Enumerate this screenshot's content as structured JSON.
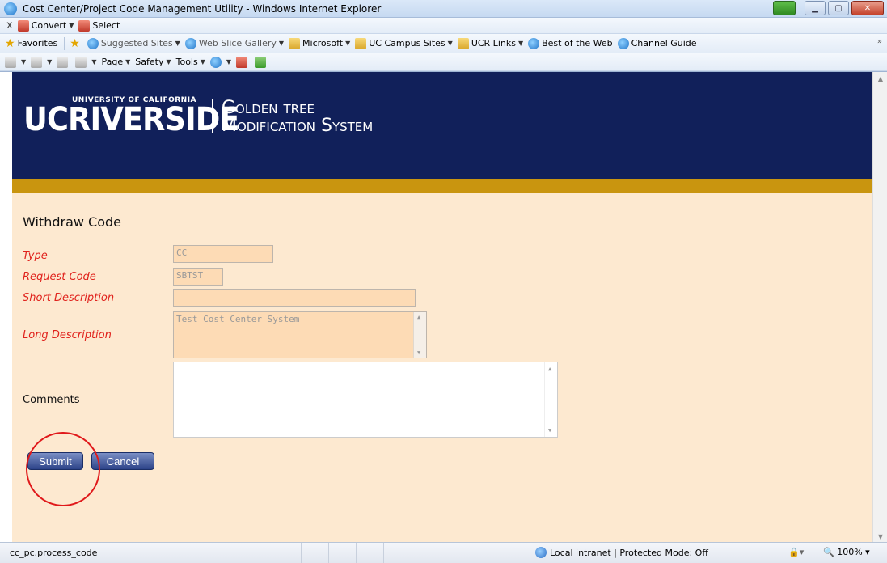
{
  "window": {
    "title": "Cost Center/Project Code Management Utility - Windows Internet Explorer"
  },
  "toolbar1": {
    "convert_label": "Convert",
    "select_label": "Select"
  },
  "favorites_bar": {
    "favorites_label": "Favorites",
    "items": [
      "Suggested Sites",
      "Web Slice Gallery",
      "Microsoft",
      "UC Campus Sites",
      "UCR Links",
      "Best of the Web",
      "Channel Guide"
    ]
  },
  "command_bar": {
    "page_label": "Page",
    "safety_label": "Safety",
    "tools_label": "Tools"
  },
  "banner": {
    "logo_uc": "UCRIVERSIDE",
    "logo_univ": "UNIVERSITY OF CALIFORNIA",
    "system_line1": "Golden tree",
    "system_line2": "Modification System"
  },
  "form": {
    "title": "Withdraw Code",
    "type_label": "Type",
    "type_value": "CC",
    "request_code_label": "Request Code",
    "request_code_value": "SBTST",
    "short_desc_label": "Short Description",
    "short_desc_value": "",
    "long_desc_label": "Long Description",
    "long_desc_value": "Test Cost Center System",
    "comments_label": "Comments",
    "comments_value": ""
  },
  "buttons": {
    "submit": "Submit",
    "cancel": "Cancel"
  },
  "statusbar": {
    "left_text": "cc_pc.process_code",
    "zone_text": "Local intranet | Protected Mode: Off",
    "zoom_text": "100%"
  },
  "colors": {
    "banner_bg": "#11205a",
    "gold_bar": "#c9950f",
    "page_bg": "#fde9d0",
    "required_label": "#e0221c",
    "button_bg": "#2c4388",
    "highlight_circle": "#e0191b"
  }
}
